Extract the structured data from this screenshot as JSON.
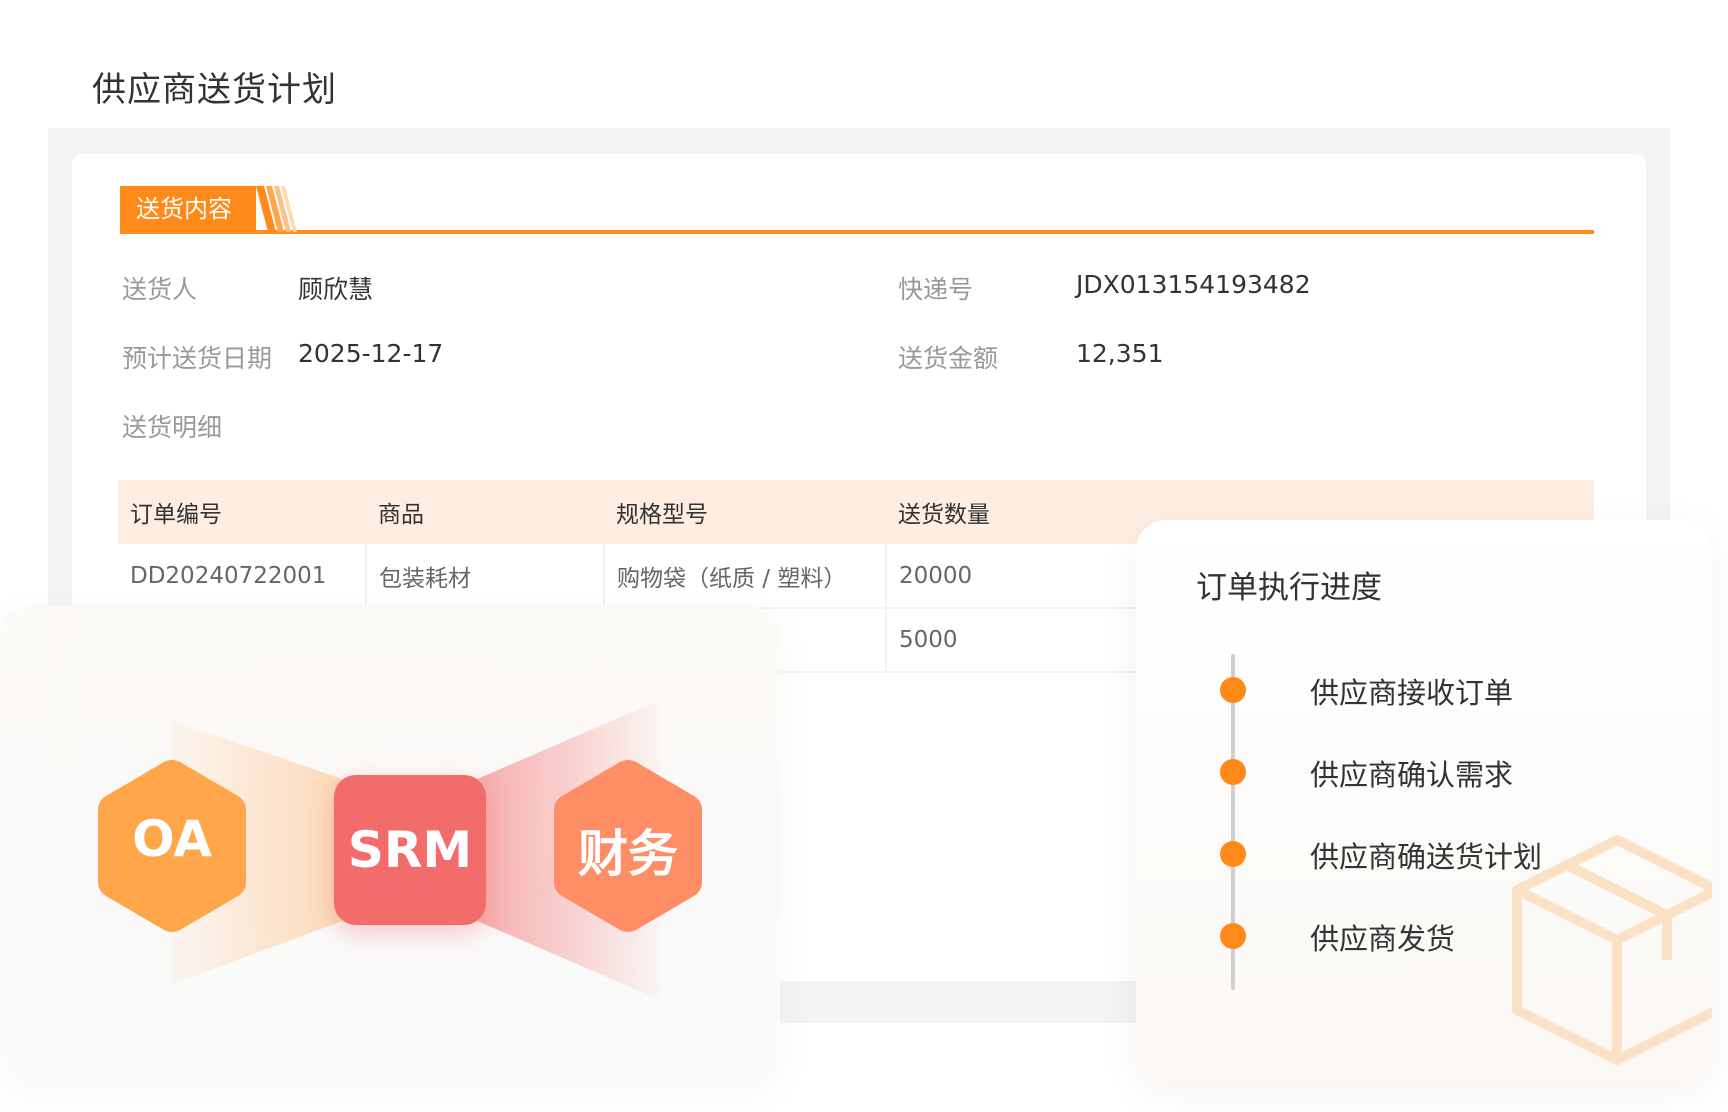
{
  "page": {
    "title": "供应商送货计划"
  },
  "section": {
    "tag": "送货内容"
  },
  "fields": {
    "sender_label": "送货人",
    "sender_value": "顾欣慧",
    "tracking_label": "快递号",
    "tracking_value": "JDX013154193482",
    "date_label": "预计送货日期",
    "date_value": "2025-12-17",
    "amount_label": "送货金额",
    "amount_value": "12,351",
    "detail_label": "送货明细"
  },
  "table": {
    "headers": [
      "订单编号",
      "商品",
      "规格型号",
      "送货数量"
    ],
    "rows": [
      [
        "DD20240722001",
        "包装耗材",
        "购物袋（纸质 / 塑料）",
        "20000"
      ],
      [
        "",
        "",
        "",
        "5000"
      ]
    ]
  },
  "integration": {
    "left": "OA",
    "center": "SRM",
    "right": "财务"
  },
  "progress": {
    "title": "订单执行进度",
    "steps": [
      "供应商接收订单",
      "供应商确认需求",
      "供应商确送货计划",
      "供应商发货"
    ]
  },
  "colors": {
    "accent": "#ff8a1a",
    "srm": "#f26c6c",
    "oa": "#ffa54a",
    "finance": "#ff8d66",
    "table_header_bg": "#fdeee1"
  },
  "icons": {
    "box": "package-icon",
    "step_marker": "timeline-dot-icon"
  }
}
